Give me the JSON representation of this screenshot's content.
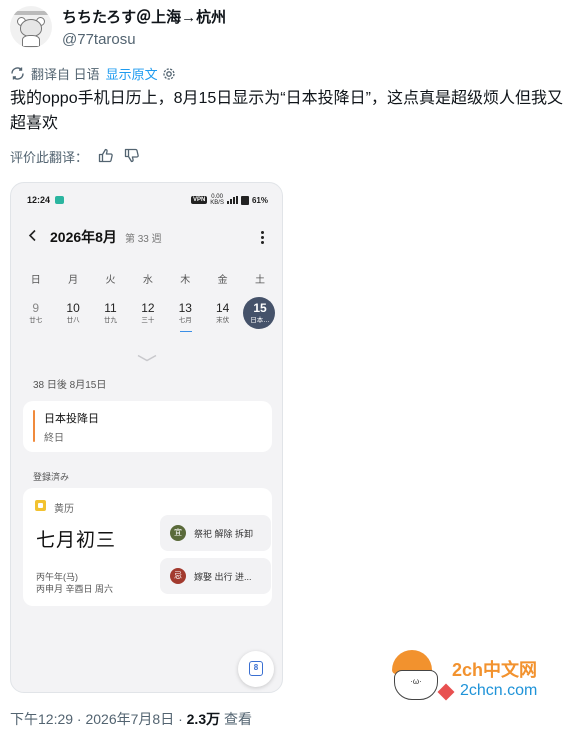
{
  "author": {
    "display_name": "ちちたろす＠上海→杭州",
    "handle": "@77tarosu"
  },
  "translation": {
    "label": "翻译自 日语",
    "show_original": "显示原文"
  },
  "tweet": {
    "text": "我的oppo手机日历上，8月15日显示为“日本投降日”，这点真是超级烦人但我又超喜欢"
  },
  "rate": {
    "label": "评价此翻译："
  },
  "phone": {
    "status": {
      "time": "12:24",
      "vpn": "VPN",
      "speed_top": "0.00",
      "speed_bottom": "KB/S",
      "battery": "61%"
    },
    "calendar": {
      "month_title": "2026年8月",
      "week_label": "第 33 週",
      "weekdays": [
        "日",
        "月",
        "火",
        "水",
        "木",
        "金",
        "土"
      ],
      "dates": [
        {
          "day": "9",
          "sub": "廿七"
        },
        {
          "day": "10",
          "sub": "廿八"
        },
        {
          "day": "11",
          "sub": "廿九"
        },
        {
          "day": "12",
          "sub": "三十"
        },
        {
          "day": "13",
          "sub": "七月"
        },
        {
          "day": "14",
          "sub": "末伏"
        },
        {
          "day": "15",
          "sub": "日本…"
        }
      ],
      "selected_index": 6,
      "today_index": 4,
      "days_after": "38 日後  8月15日",
      "event": {
        "title": "日本投降日",
        "subtitle": "終日",
        "accent_color": "#f08a3c"
      },
      "registered_label": "登録済み",
      "almanac": {
        "label": "黄历",
        "lunar_date": "七月初三",
        "ganzhi_line1": "丙午年(马)",
        "ganzhi_line2": "丙申月 辛酉日 周六",
        "yi_badge": "宜",
        "yi_items": "祭祀  解除  拆卸",
        "ji_badge": "忌",
        "ji_items": "嫁娶  出行  进..."
      },
      "fab_day": "8"
    }
  },
  "footer": {
    "timestamp": "下午12:29 · 2026年7月8日 · ",
    "views_count": "2.3万",
    "views_label": " 查看"
  },
  "watermark": {
    "line1": "2ch中文网",
    "line2": "2chcn.com"
  }
}
